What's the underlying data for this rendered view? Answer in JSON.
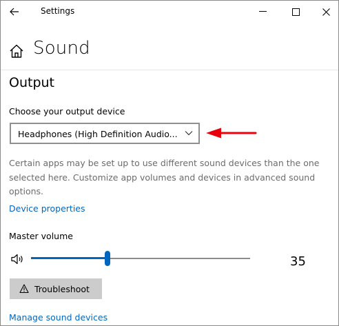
{
  "window": {
    "title": "Settings",
    "back_icon": "back-arrow-icon",
    "minimize_icon": "minimize-icon",
    "maximize_icon": "maximize-icon",
    "close_icon": "close-icon"
  },
  "page": {
    "title": "Sound",
    "home_icon": "home-icon"
  },
  "output": {
    "section_title": "Output",
    "device_label": "Choose your output device",
    "selected_device": "Headphones (High Definition Audio...",
    "dropdown_icon": "chevron-down-icon",
    "annotation_arrow_color": "#e8000a",
    "help_text": "Certain apps may be set up to use different sound devices than the one selected here. Customize app volumes and devices in advanced sound options.",
    "device_properties_link": "Device properties",
    "master_volume_label": "Master volume",
    "volume_icon": "speaker-icon",
    "volume_value": "35",
    "volume_level": 35,
    "troubleshoot_label": "Troubleshoot",
    "troubleshoot_icon": "warning-icon",
    "manage_devices_link": "Manage sound devices"
  },
  "colors": {
    "accent": "#0067c0",
    "button_bg": "#cccccc",
    "help_text": "#6b6b6b",
    "arrow": "#e8000a"
  }
}
